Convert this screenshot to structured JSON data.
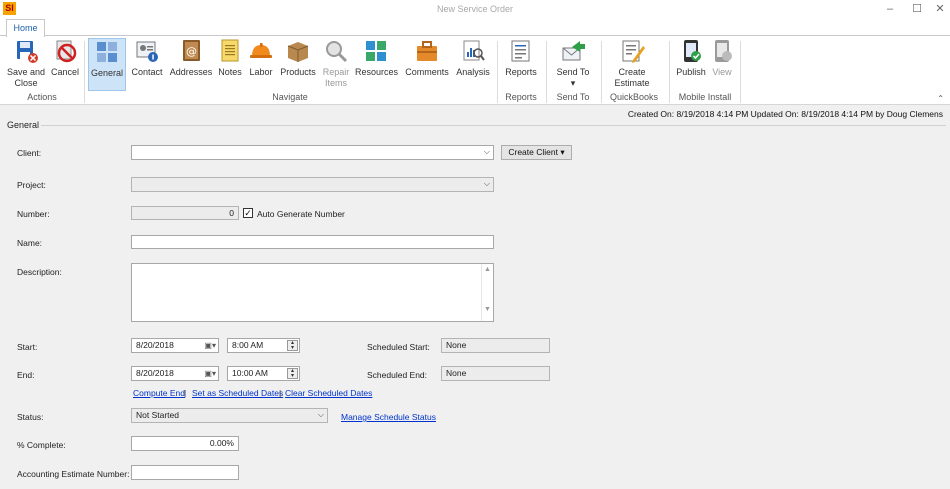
{
  "window": {
    "title": "New Service Order",
    "logo": "SI"
  },
  "tabs": [
    {
      "label": "Home"
    }
  ],
  "ribbon": {
    "groups": [
      {
        "label": "Actions"
      },
      {
        "label": "Navigate"
      },
      {
        "label": "Reports"
      },
      {
        "label": "Send To"
      },
      {
        "label": "QuickBooks"
      },
      {
        "label": "Mobile Install"
      }
    ],
    "buttons": [
      {
        "label": "Save and Close",
        "icon": "save-icon"
      },
      {
        "label": "Cancel",
        "icon": "cancel-icon"
      },
      {
        "label": "General",
        "icon": "general-icon"
      },
      {
        "label": "Contact",
        "icon": "contact-icon"
      },
      {
        "label": "Addresses",
        "icon": "addresses-icon"
      },
      {
        "label": "Notes",
        "icon": "notes-icon"
      },
      {
        "label": "Labor",
        "icon": "hardhat-icon"
      },
      {
        "label": "Products",
        "icon": "box-icon"
      },
      {
        "label": "Repair Items",
        "icon": "magnifier-icon"
      },
      {
        "label": "Resources",
        "icon": "resources-icon"
      },
      {
        "label": "Comments",
        "icon": "comments-icon"
      },
      {
        "label": "Analysis",
        "icon": "analysis-icon"
      },
      {
        "label": "Reports",
        "icon": "reports-icon"
      },
      {
        "label": "Send To",
        "icon": "send-icon"
      },
      {
        "label": "Create Estimate",
        "icon": "estimate-icon"
      },
      {
        "label": "Publish",
        "icon": "publish-icon"
      },
      {
        "label": "View",
        "icon": "view-icon"
      }
    ]
  },
  "info": {
    "text": "Created On: 8/19/2018 4:14 PM  Updated On: 8/19/2018 4:14 PM by Doug Clemens"
  },
  "section": {
    "title": "General"
  },
  "form": {
    "client_label": "Client:",
    "client_value": "",
    "create_client_label": "Create Client",
    "project_label": "Project:",
    "project_value": "",
    "number_label": "Number:",
    "number_value": "0",
    "auto_generate_label": "Auto Generate Number",
    "auto_generate_checked": true,
    "name_label": "Name:",
    "name_value": "",
    "description_label": "Description:",
    "description_value": "",
    "start_label": "Start:",
    "start_date": "8/20/2018",
    "start_time": "8:00 AM",
    "scheduled_start_label": "Scheduled Start:",
    "scheduled_start_value": "None",
    "end_label": "End:",
    "end_date": "8/20/2018",
    "end_time": "10:00 AM",
    "scheduled_end_label": "Scheduled End:",
    "scheduled_end_value": "None",
    "compute_end_link": "Compute End",
    "set_scheduled_link": "Set as Scheduled Dates",
    "clear_scheduled_link": "Clear Scheduled Dates",
    "link_separator": "|",
    "status_label": "Status:",
    "status_value": "Not Started",
    "manage_status_link": "Manage Schedule Status",
    "percent_label": "% Complete:",
    "percent_value": "0.00%",
    "acct_estimate_label": "Accounting Estimate Number:",
    "acct_estimate_value": ""
  },
  "colors": {
    "accent": "#1e62b0",
    "link": "#0033cc",
    "active_button_bg": "#cde3f7"
  }
}
